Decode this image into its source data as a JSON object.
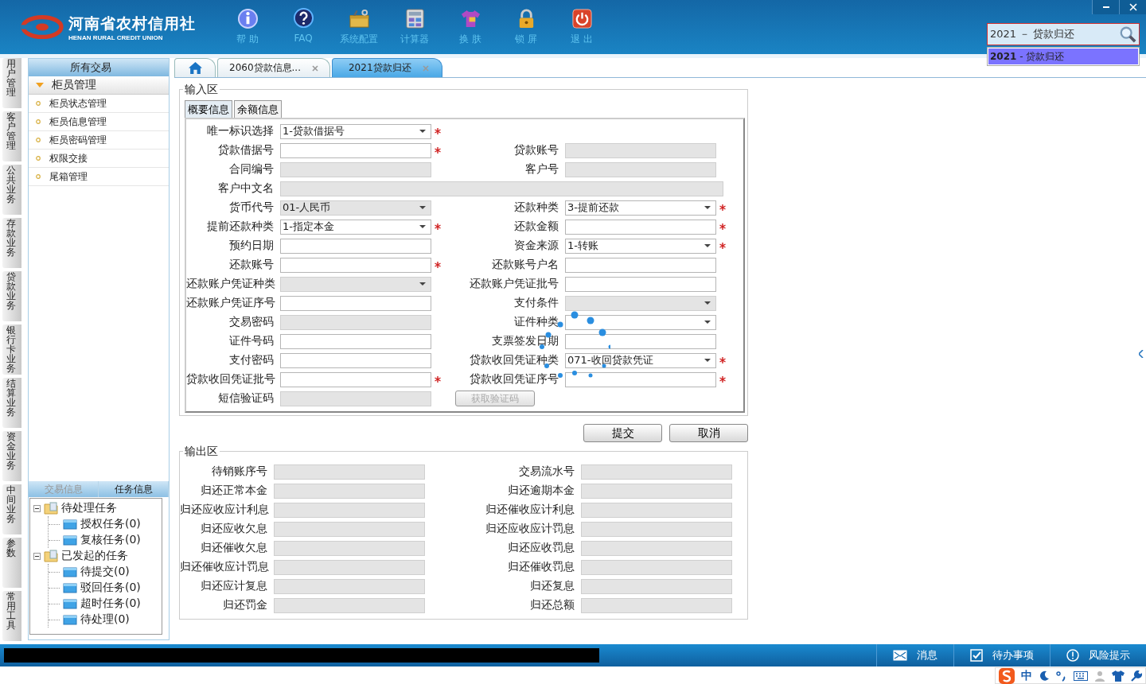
{
  "header": {
    "logo_name": "河南省农村信用社",
    "logo_subtitle": "HENAN RURAL CREDIT UNION",
    "tools": [
      {
        "kind": "help",
        "label": "帮 助"
      },
      {
        "kind": "faq",
        "label": "FAQ"
      },
      {
        "kind": "config",
        "label": "系统配置"
      },
      {
        "kind": "calculator",
        "label": "计算器"
      },
      {
        "kind": "skin",
        "label": "换 肤"
      },
      {
        "kind": "lock",
        "label": "锁 屏"
      },
      {
        "kind": "exit",
        "label": "退 出"
      }
    ],
    "search": {
      "value": "2021 － 贷款归还",
      "suggestions": [
        {
          "text": "**2021** - 贷款归还",
          "selected": true
        }
      ]
    }
  },
  "side_tabs": [
    "用户管理",
    "客户管理",
    "公共业务",
    "存款业务",
    "贷款业务",
    "银行卡业务",
    "结算业务",
    "资金业务",
    "中间业务",
    "参数",
    "常用工具"
  ],
  "sidebar": {
    "title": "所有交易",
    "group": {
      "label": "柜员管理",
      "expanded": true,
      "items": [
        "柜员状态管理",
        "柜员信息管理",
        "柜员密码管理",
        "权限交接",
        "尾箱管理"
      ]
    },
    "info_tabs": [
      {
        "label": "交易信息",
        "selected": false
      },
      {
        "label": "任务信息",
        "selected": true
      }
    ],
    "tree": [
      {
        "label": "待处理任务",
        "expanded": true,
        "children": [
          {
            "label": "授权任务(0)"
          },
          {
            "label": "复核任务(0)"
          }
        ]
      },
      {
        "label": "已发起的任务",
        "expanded": true,
        "children": [
          {
            "label": "待提交(0)"
          },
          {
            "label": "驳回任务(0)"
          },
          {
            "label": "超时任务(0)"
          },
          {
            "label": "待处理(0)"
          }
        ]
      }
    ]
  },
  "tabs": [
    {
      "kind": "home",
      "selected": false
    },
    {
      "kind": "page",
      "label": "2060贷款信息...",
      "selected": false
    },
    {
      "kind": "page",
      "label": "2021贷款归还",
      "selected": true
    }
  ],
  "input_area": {
    "title": "输入区",
    "tabs": [
      {
        "label": "概要信息",
        "selected": true
      },
      {
        "label": "余额信息",
        "selected": false
      }
    ],
    "rows": [
      [
        {
          "label": "唯一标识选择",
          "kind": "select",
          "value": "1-贷款借据号",
          "disabled": false,
          "required": true
        }
      ],
      [
        {
          "label": "贷款借据号",
          "kind": "text",
          "disabled": false,
          "required": true
        },
        {
          "label": "贷款账号",
          "kind": "text",
          "disabled": true,
          "required": false
        }
      ],
      [
        {
          "label": "合同编号",
          "kind": "text",
          "disabled": true,
          "required": false
        },
        {
          "label": "客户号",
          "kind": "text",
          "disabled": true,
          "required": false
        }
      ],
      [
        {
          "label": "客户中文名",
          "kind": "wide",
          "disabled": true
        }
      ],
      [
        {
          "label": "货币代号",
          "kind": "select",
          "value": "01-人民币",
          "disabled": true,
          "required": false
        },
        {
          "label": "还款种类",
          "kind": "select",
          "value": "3-提前还款",
          "disabled": false,
          "required": true
        }
      ],
      [
        {
          "label": "提前还款种类",
          "kind": "select",
          "value": "1-指定本金",
          "disabled": false,
          "required": true
        },
        {
          "label": "还款金额",
          "kind": "text",
          "disabled": false,
          "required": true
        }
      ],
      [
        {
          "label": "预约日期",
          "kind": "text",
          "disabled": false,
          "required": false
        },
        {
          "label": "资金来源",
          "kind": "select",
          "value": "1-转账",
          "disabled": false,
          "required": true
        }
      ],
      [
        {
          "label": "还款账号",
          "kind": "text",
          "disabled": false,
          "required": true
        },
        {
          "label": "还款账号户名",
          "kind": "text",
          "disabled": false,
          "required": false
        }
      ],
      [
        {
          "label": "还款账户凭证种类",
          "kind": "select",
          "disabled": true,
          "required": false
        },
        {
          "label": "还款账户凭证批号",
          "kind": "text",
          "disabled": false,
          "required": false
        }
      ],
      [
        {
          "label": "还款账户凭证序号",
          "kind": "text",
          "disabled": false,
          "required": false
        },
        {
          "label": "支付条件",
          "kind": "select",
          "disabled": true,
          "required": false
        }
      ],
      [
        {
          "label": "交易密码",
          "kind": "text",
          "disabled": true,
          "required": false
        },
        {
          "label": "证件种类",
          "kind": "select",
          "disabled": false,
          "required": false
        }
      ],
      [
        {
          "label": "证件号码",
          "kind": "text",
          "disabled": false,
          "required": false
        },
        {
          "label": "支票签发日期",
          "kind": "text",
          "disabled": false,
          "required": false
        }
      ],
      [
        {
          "label": "支付密码",
          "kind": "text",
          "disabled": false,
          "required": false
        },
        {
          "label": "贷款收回凭证种类",
          "kind": "select",
          "value": "071-收回贷款凭证",
          "disabled": false,
          "required": true
        }
      ],
      [
        {
          "label": "贷款收回凭证批号",
          "kind": "text",
          "disabled": false,
          "required": true
        },
        {
          "label": "贷款收回凭证序号",
          "kind": "text",
          "disabled": false,
          "required": true
        }
      ],
      [
        {
          "label": "短信验证码",
          "kind": "text",
          "disabled": true,
          "required": false
        },
        {
          "label": "获取验证码",
          "kind": "button",
          "disabled": true
        }
      ]
    ]
  },
  "actions": [
    "提交",
    "取消"
  ],
  "output_area": {
    "title": "输出区",
    "rows": [
      [
        "待销账序号",
        "交易流水号"
      ],
      [
        "归还正常本金",
        "归还逾期本金"
      ],
      [
        "归还应收应计利息",
        "归还催收应计利息"
      ],
      [
        "归还应收欠息",
        "归还应收应计罚息"
      ],
      [
        "归还催收欠息",
        "归还应收罚息"
      ],
      [
        "归还催收应计罚息",
        "归还催收罚息"
      ],
      [
        "归还应计复息",
        "归还复息"
      ],
      [
        "归还罚金",
        "归还总额"
      ]
    ]
  },
  "status_bar": {
    "items": [
      {
        "kind": "message",
        "label": "消息"
      },
      {
        "kind": "todo",
        "label": "待办事项"
      },
      {
        "kind": "risk",
        "label": "风险提示"
      }
    ]
  },
  "ime": {
    "mode": "中"
  }
}
